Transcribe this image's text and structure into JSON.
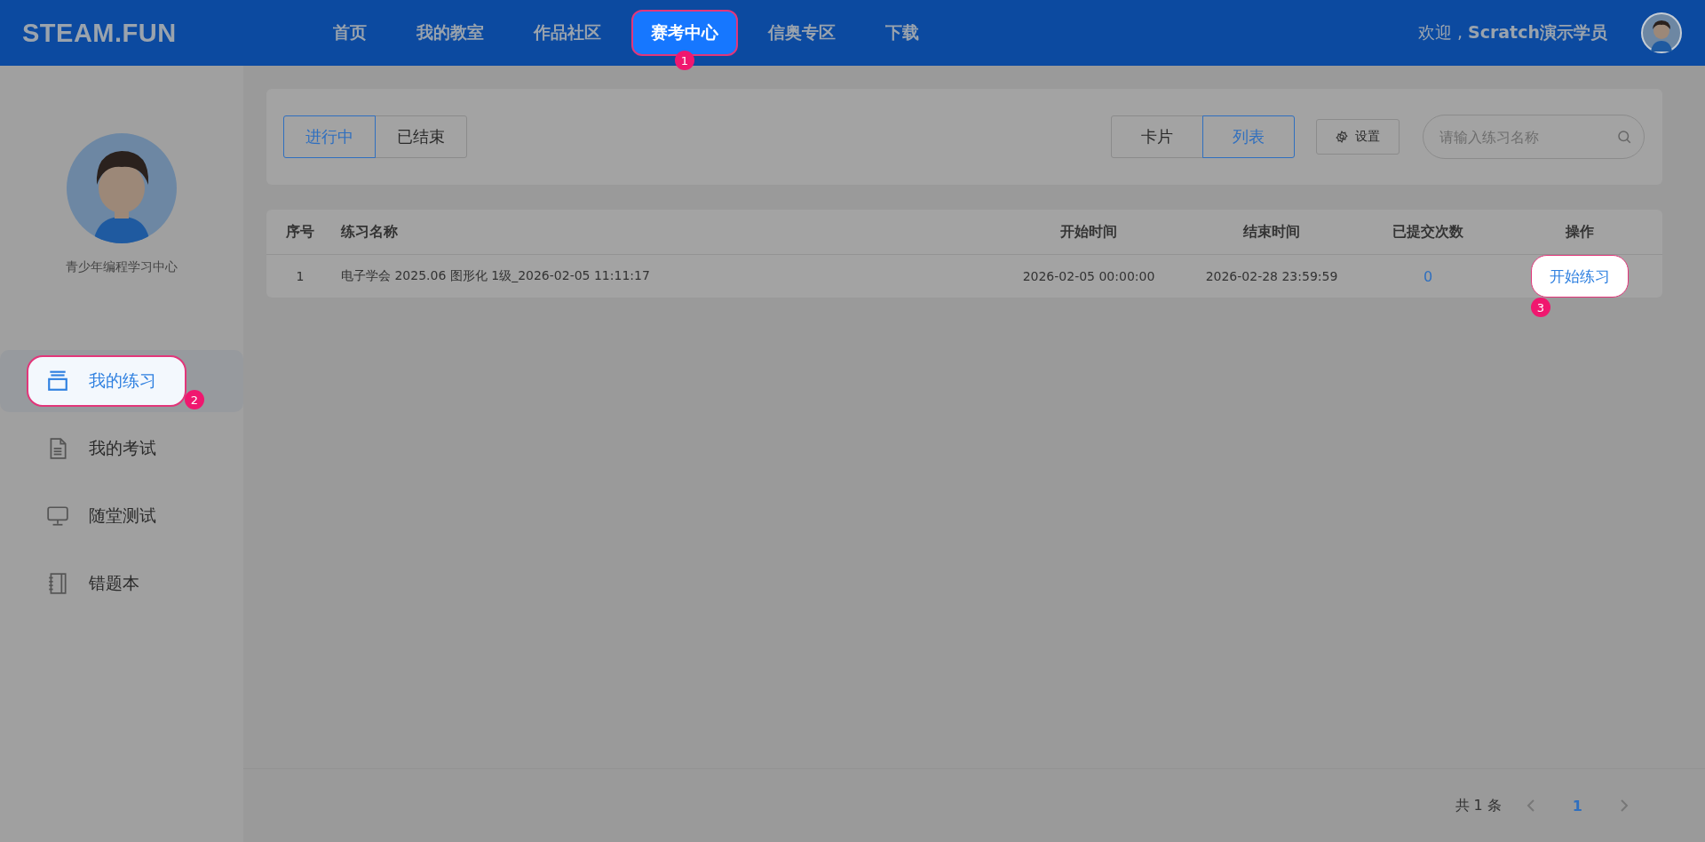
{
  "header": {
    "logo": "STEAM.FUN",
    "nav": [
      {
        "label": "首页",
        "selected": false
      },
      {
        "label": "我的教室",
        "selected": false
      },
      {
        "label": "作品社区",
        "selected": false
      },
      {
        "label": "赛考中心",
        "selected": true,
        "step": "1"
      },
      {
        "label": "信奥专区",
        "selected": false
      },
      {
        "label": "下载",
        "selected": false
      }
    ],
    "welcome": "欢迎 , **Scratch演示学员**"
  },
  "sidebar": {
    "org": "青少年编程学习中心",
    "items": [
      {
        "label": "我的练习",
        "selected": true,
        "step": "2"
      },
      {
        "label": "我的考试",
        "selected": false
      },
      {
        "label": "随堂测试",
        "selected": false
      },
      {
        "label": "错题本",
        "selected": false
      }
    ]
  },
  "toolbar": {
    "status_tabs": [
      {
        "label": "进行中",
        "selected": true
      },
      {
        "label": "已结束",
        "selected": false
      }
    ],
    "view_tabs": [
      {
        "label": "卡片",
        "selected": false
      },
      {
        "label": "列表",
        "selected": true
      }
    ],
    "settings_button": "设置",
    "search": {
      "placeholder": "请输入练习名称"
    }
  },
  "table": {
    "columns": [
      "序号",
      "练习名称",
      "开始时间",
      "结束时间",
      "已提交次数",
      "操作"
    ],
    "rows": [
      {
        "cells": [
          "1",
          "电子学会 2025.06 图形化 1级_2026-02-05 11:11:17",
          "2026-02-05 00:00:00",
          "2026-02-28 23:59:59",
          "0"
        ],
        "action": "开始练习",
        "step": "3"
      }
    ]
  },
  "pagination": {
    "total": "共 1 条",
    "pages": [
      {
        "label": "1",
        "selected": true
      }
    ]
  }
}
